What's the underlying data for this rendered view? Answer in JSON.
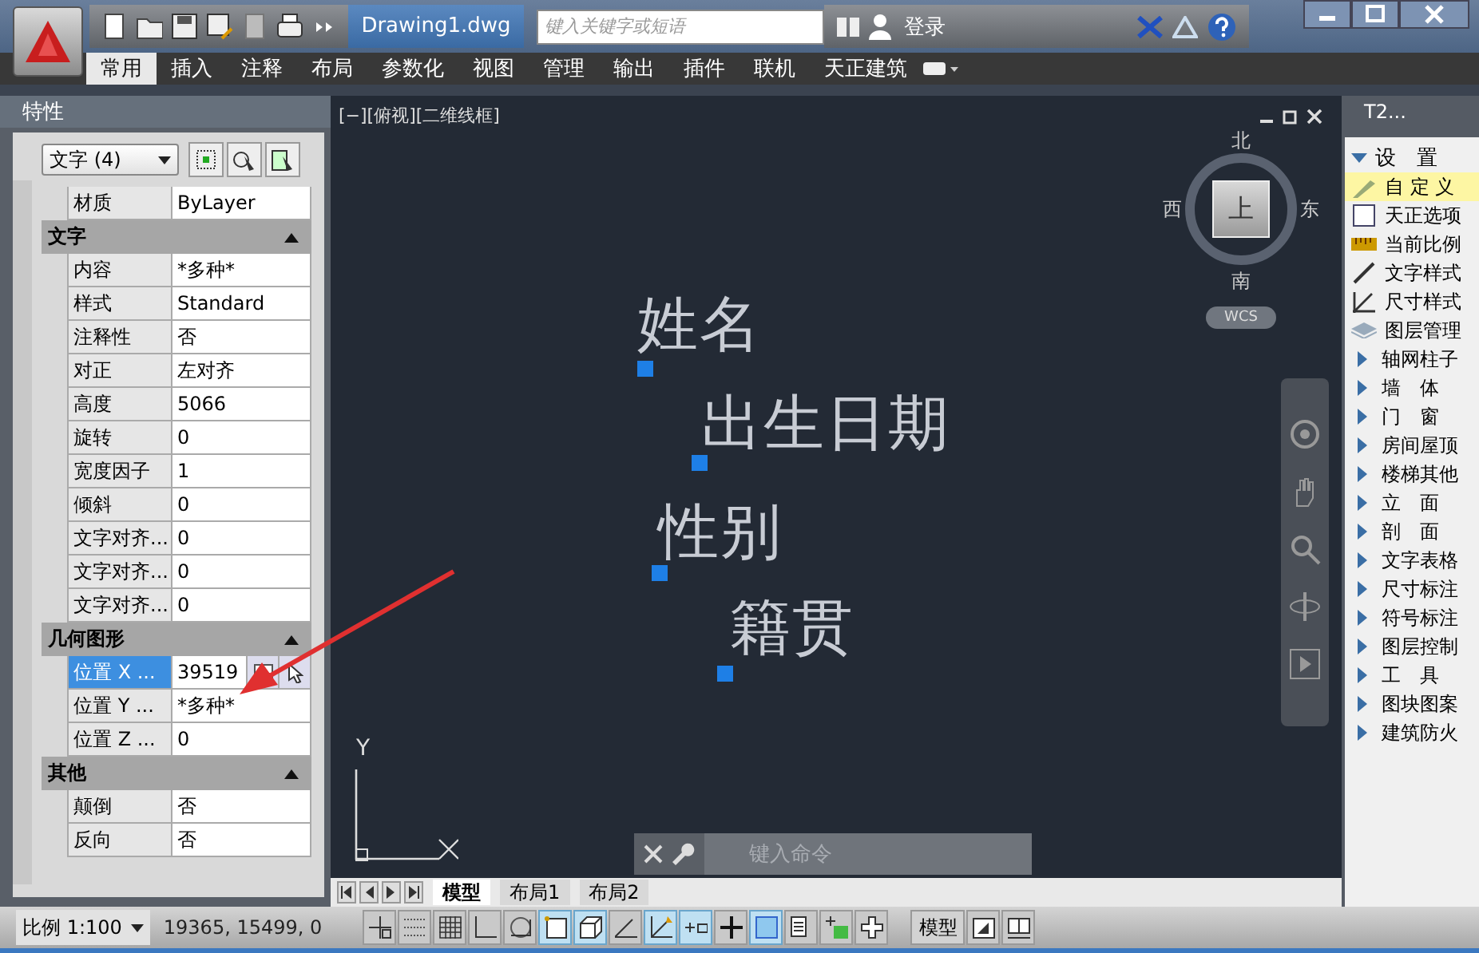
{
  "title_bar": {
    "document_title": "Drawing1.dwg",
    "search": {
      "placeholder": "键入关键字或短语"
    },
    "login": "登录"
  },
  "ribbon_tabs": [
    {
      "label": "常用",
      "selected": true
    },
    {
      "label": "插入",
      "selected": false
    },
    {
      "label": "注释",
      "selected": false
    },
    {
      "label": "布局",
      "selected": false
    },
    {
      "label": "参数化",
      "selected": false
    },
    {
      "label": "视图",
      "selected": false
    },
    {
      "label": "管理",
      "selected": false
    },
    {
      "label": "输出",
      "selected": false
    },
    {
      "label": "插件",
      "selected": false
    },
    {
      "label": "联机",
      "selected": false
    },
    {
      "label": "天正建筑",
      "selected": false
    }
  ],
  "properties_palette": {
    "title": "特性",
    "selection": "文字 (4)",
    "top_rows": [
      {
        "label": "材质",
        "value": "ByLayer",
        "selected": false
      }
    ],
    "sections": [
      {
        "title": "文字",
        "expanded": true,
        "rows": [
          {
            "label": "内容",
            "value": "*多种*",
            "selected": false
          },
          {
            "label": "样式",
            "value": "Standard",
            "selected": false
          },
          {
            "label": "注释性",
            "value": "否",
            "selected": false
          },
          {
            "label": "对正",
            "value": "左对齐",
            "selected": false
          },
          {
            "label": "高度",
            "value": "5066",
            "selected": false
          },
          {
            "label": "旋转",
            "value": "0",
            "selected": false
          },
          {
            "label": "宽度因子",
            "value": "1",
            "selected": false
          },
          {
            "label": "倾斜",
            "value": "0",
            "selected": false
          },
          {
            "label": "文字对齐...",
            "value": "0",
            "selected": false
          },
          {
            "label": "文字对齐...",
            "value": "0",
            "selected": false
          },
          {
            "label": "文字对齐...",
            "value": "0",
            "selected": false
          }
        ]
      },
      {
        "title": "几何图形",
        "expanded": true,
        "rows": [
          {
            "label": "位置 X ...",
            "value": "39519",
            "selected": true
          },
          {
            "label": "位置 Y ...",
            "value": "*多种*",
            "selected": false
          },
          {
            "label": "位置 Z ...",
            "value": "0",
            "selected": false
          }
        ]
      },
      {
        "title": "其他",
        "expanded": true,
        "rows": [
          {
            "label": "颠倒",
            "value": "否",
            "selected": false
          },
          {
            "label": "反向",
            "value": "否",
            "selected": false
          }
        ]
      }
    ]
  },
  "viewport": {
    "label": "[−][俯视][二维线框]",
    "viewcube": {
      "north": "北",
      "south": "南",
      "east": "东",
      "west": "西",
      "face": "上",
      "coordinate_system": "WCS"
    },
    "drawing_texts": [
      "姓名",
      "出生日期",
      "性别",
      "籍贯"
    ],
    "ucs_axis": "Y",
    "command_line": {
      "placeholder": "键入命令"
    },
    "layout_tabs": [
      {
        "label": "模型",
        "selected": true
      },
      {
        "label": "布局1",
        "selected": false
      },
      {
        "label": "布局2",
        "selected": false
      }
    ]
  },
  "tool_palette": {
    "title": "T2...",
    "items": [
      {
        "kind": "header",
        "label": "设　置"
      },
      {
        "kind": "tool",
        "label": "自 定 义",
        "selected": true
      },
      {
        "kind": "tool",
        "label": "天正选项",
        "selected": false
      },
      {
        "kind": "tool",
        "label": "当前比例",
        "selected": false
      },
      {
        "kind": "tool",
        "label": "文字样式",
        "selected": false
      },
      {
        "kind": "tool",
        "label": "尺寸样式",
        "selected": false
      },
      {
        "kind": "tool",
        "label": "图层管理",
        "selected": false
      },
      {
        "kind": "category",
        "label": "轴网柱子"
      },
      {
        "kind": "category",
        "label": "墙　体"
      },
      {
        "kind": "category",
        "label": "门　窗"
      },
      {
        "kind": "category",
        "label": "房间屋顶"
      },
      {
        "kind": "category",
        "label": "楼梯其他"
      },
      {
        "kind": "category",
        "label": "立　面"
      },
      {
        "kind": "category",
        "label": "剖　面"
      },
      {
        "kind": "category",
        "label": "文字表格"
      },
      {
        "kind": "category",
        "label": "尺寸标注"
      },
      {
        "kind": "category",
        "label": "符号标注"
      },
      {
        "kind": "category",
        "label": "图层控制"
      },
      {
        "kind": "category",
        "label": "工　具"
      },
      {
        "kind": "category",
        "label": "图块图案"
      },
      {
        "kind": "category",
        "label": "建筑防火"
      }
    ]
  },
  "status_bar": {
    "scale": "比例 1:100",
    "coordinates": "19365, 15499, 0",
    "toggles": [
      {
        "kind": "snap",
        "on": false
      },
      {
        "kind": "dots",
        "on": false
      },
      {
        "kind": "grid",
        "on": false
      },
      {
        "kind": "ortho",
        "on": false
      },
      {
        "kind": "polar",
        "on": false
      },
      {
        "kind": "osnap",
        "on": true
      },
      {
        "kind": "osnap3d",
        "on": true
      },
      {
        "kind": "angle",
        "on": false
      },
      {
        "kind": "ducs",
        "on": true
      },
      {
        "kind": "lineweight",
        "on": true
      },
      {
        "kind": "plus",
        "on": false
      },
      {
        "kind": "transparency",
        "on": true
      },
      {
        "kind": "properties",
        "on": false
      },
      {
        "kind": "cycle",
        "on": false
      },
      {
        "kind": "cross",
        "on": false
      }
    ],
    "space": "模型"
  }
}
